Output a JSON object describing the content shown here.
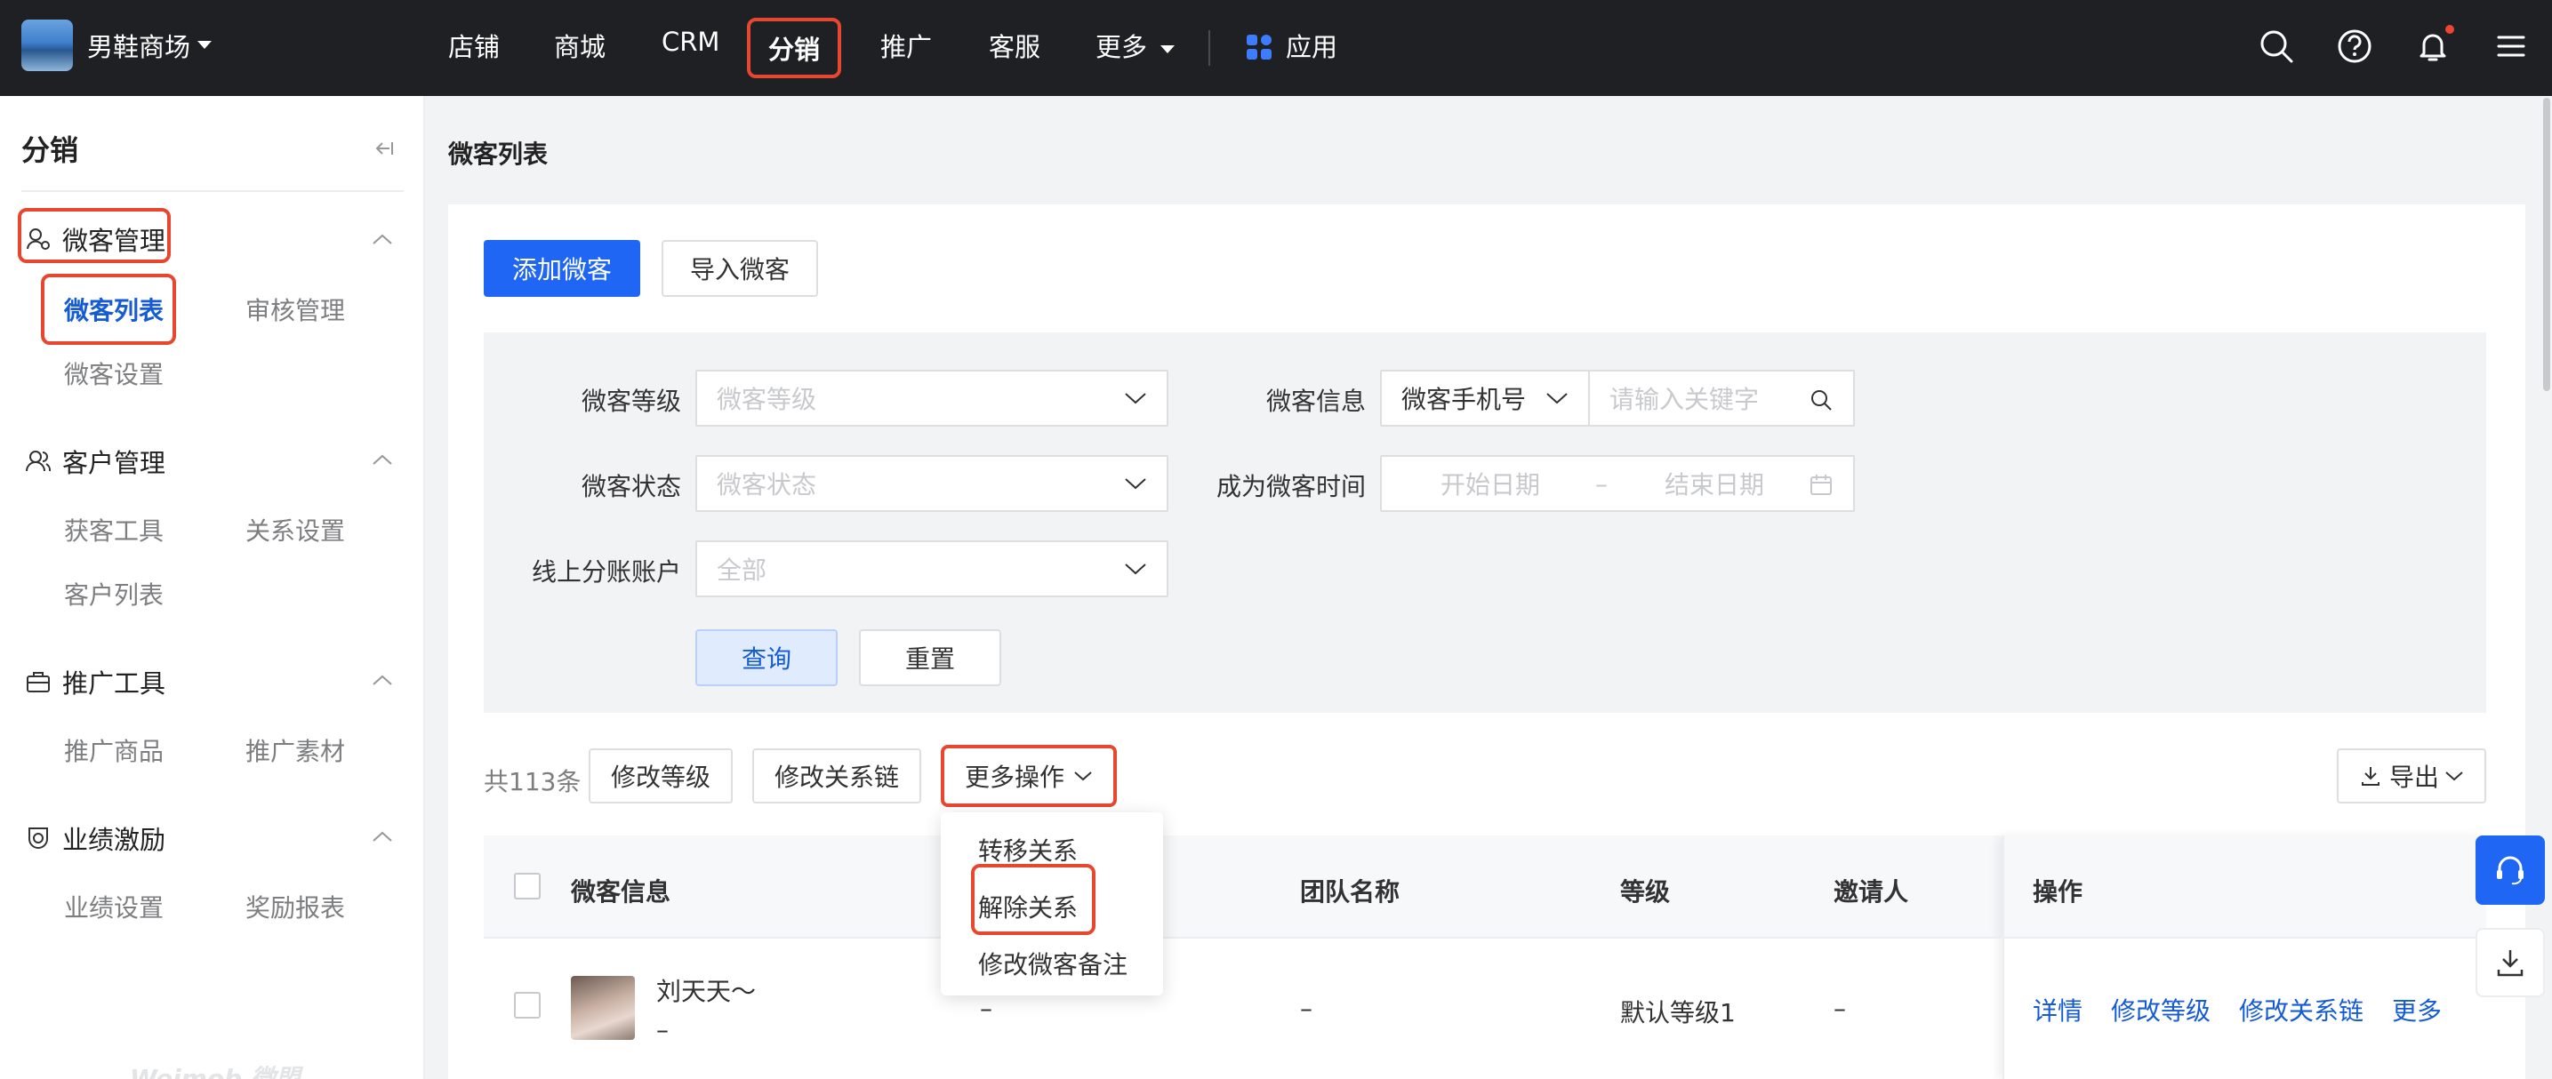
{
  "header": {
    "shop_name": "男鞋商场",
    "nav": [
      "店铺",
      "商城",
      "CRM",
      "分销",
      "推广",
      "客服",
      "更多",
      "应用"
    ],
    "active_nav": "分销"
  },
  "sidebar": {
    "title": "分销",
    "groups": [
      {
        "label": "微客管理",
        "items": [
          "微客列表",
          "审核管理",
          "微客设置"
        ]
      },
      {
        "label": "客户管理",
        "items": [
          "获客工具",
          "关系设置",
          "客户列表"
        ]
      },
      {
        "label": "推广工具",
        "items": [
          "推广商品",
          "推广素材"
        ]
      },
      {
        "label": "业绩激励",
        "items": [
          "业绩设置",
          "奖励报表"
        ]
      }
    ],
    "active_item": "微客列表",
    "watermark": "Weimob 微盟"
  },
  "page": {
    "title": "微客列表",
    "add_button": "添加微客",
    "import_button": "导入微客"
  },
  "filters": {
    "level_label": "微客等级",
    "level_placeholder": "微客等级",
    "status_label": "微客状态",
    "status_placeholder": "微客状态",
    "account_label": "线上分账账户",
    "account_value": "全部",
    "info_label": "微客信息",
    "info_type": "微客手机号",
    "keyword_placeholder": "请输入关键字",
    "time_label": "成为微客时间",
    "start_date": "开始日期",
    "date_sep": "–",
    "end_date": "结束日期",
    "query_button": "查询",
    "reset_button": "重置"
  },
  "toolbar": {
    "total": "共113条",
    "modify_level": "修改等级",
    "modify_chain": "修改关系链",
    "more_ops": "更多操作",
    "export": "导出"
  },
  "more_ops_menu": [
    "转移关系",
    "解除关系",
    "修改微客备注"
  ],
  "table": {
    "columns": [
      "微客信息",
      "团队名称",
      "等级",
      "邀请人",
      "操作"
    ],
    "rows": [
      {
        "name": "刘天天～",
        "sub": "–",
        "col2": "–",
        "team": "–",
        "level": "默认等级1",
        "inviter": "–",
        "actions": [
          "详情",
          "修改等级",
          "修改关系链",
          "更多"
        ]
      }
    ]
  },
  "colors": {
    "accent": "#1f66f5",
    "highlight": "#e8472f",
    "topbar": "#1f2024"
  }
}
